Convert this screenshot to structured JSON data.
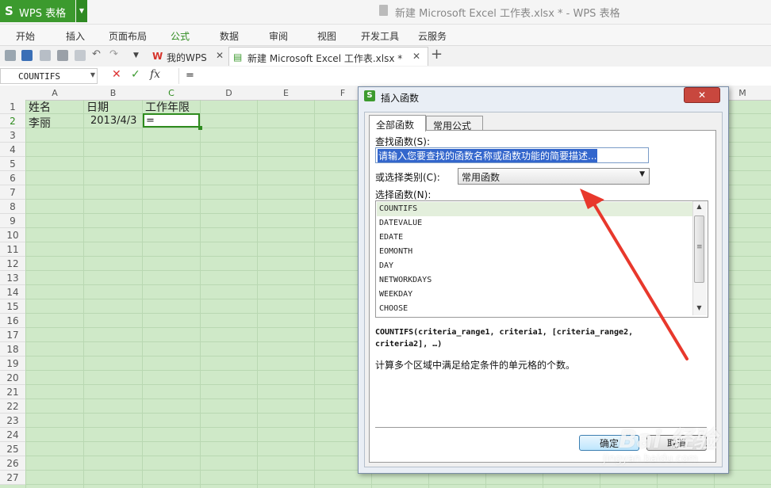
{
  "app": {
    "name": "WPS 表格",
    "logo": "S",
    "window_title": "新建 Microsoft Excel 工作表.xlsx * - WPS 表格",
    "brand_color": "#3c9a2e"
  },
  "menu": {
    "items": [
      "开始",
      "插入",
      "页面布局",
      "公式",
      "数据",
      "审阅",
      "视图",
      "开发工具",
      "云服务"
    ],
    "active": "公式"
  },
  "tabs": {
    "wps_tab": "我的WPS",
    "doc_tab": "新建 Microsoft Excel 工作表.xlsx *",
    "add": "+"
  },
  "formula_bar": {
    "name_box": "COUNTIFS",
    "cancel": "✕",
    "enter": "✓",
    "fx": "fx",
    "content": "="
  },
  "sheet": {
    "columns": [
      "A",
      "B",
      "C",
      "D",
      "E",
      "F",
      "M"
    ],
    "rows": [
      "1",
      "2",
      "3",
      "4",
      "5",
      "6",
      "7",
      "8",
      "9",
      "10",
      "11",
      "12",
      "13",
      "14",
      "15",
      "16",
      "17",
      "18",
      "19",
      "20",
      "21",
      "22",
      "23",
      "24",
      "25",
      "26",
      "27"
    ],
    "cells": {
      "A1": "姓名",
      "B1": "日期",
      "C1": "工作年限",
      "A2": "李丽",
      "B2": "2013/4/3",
      "C2": "="
    },
    "grid_color": "#b9d8b2",
    "fill_color": "#cfe9c8"
  },
  "dialog": {
    "title": "插入函数",
    "close": "✕",
    "tab_all": "全部函数",
    "tab_common": "常用公式",
    "search_label": "查找函数(S):",
    "search_value": "请输入您要查找的函数名称或函数功能的简要描述...",
    "category_label": "或选择类别(C):",
    "category_value": "常用函数",
    "list_label": "选择函数(N):",
    "functions": [
      "COUNTIFS",
      "DATEVALUE",
      "EDATE",
      "EOMONTH",
      "DAY",
      "NETWORKDAYS",
      "WEEKDAY",
      "CHOOSE"
    ],
    "selected_function": "COUNTIFS",
    "signature_line1": "COUNTIFS(criteria_range1, criteria1, [criteria_range2,",
    "signature_line2": "criteria2], …)",
    "description": "计算多个区域中满足给定条件的单元格的个数。",
    "ok": "确定",
    "cancel": "取消"
  },
  "annotation": {
    "arrow_color": "#e8382c"
  },
  "watermark": {
    "line1": "Bai 经验",
    "line2": "jingyan.baidu.com"
  }
}
